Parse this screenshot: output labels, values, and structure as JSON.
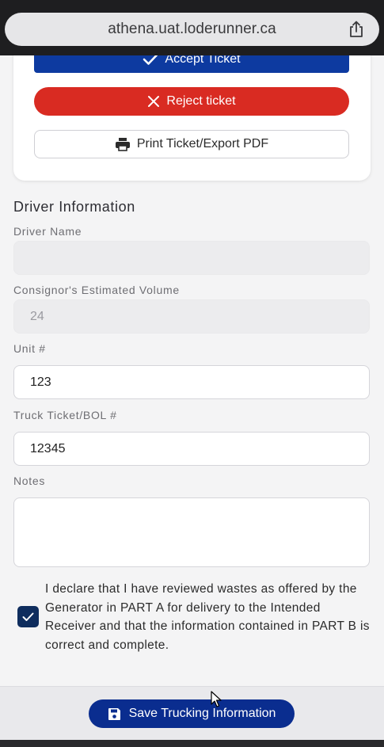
{
  "browser": {
    "url": "athena.uat.loderunner.ca"
  },
  "actions": {
    "accept_label": "Accept Ticket",
    "reject_label": "Reject ticket",
    "print_label": "Print Ticket/Export PDF"
  },
  "driver": {
    "section_title": "Driver Information",
    "driver_name_label": "Driver Name",
    "driver_name_value": "",
    "volume_label": "Consignor's Estimated Volume",
    "volume_value": "24",
    "unit_label": "Unit #",
    "unit_value": "123",
    "truck_ticket_label": "Truck Ticket/BOL #",
    "truck_ticket_value": "12345",
    "notes_label": "Notes",
    "notes_value": ""
  },
  "declaration": {
    "checked": true,
    "text": "I declare that I have reviewed wastes as offered by the Generator in PART A for delivery to the Intended Receiver and that the information contained in PART B is correct and complete."
  },
  "footer": {
    "save_label": "Save Trucking Information"
  },
  "colors": {
    "accept": "#0d3aa0",
    "reject": "#d92b22",
    "save": "#0a2d8f",
    "checkbox": "#0f2d5e"
  },
  "icons": [
    "share-icon",
    "check-icon",
    "x-icon",
    "printer-icon",
    "checkmark-icon",
    "save-icon",
    "cursor-icon"
  ]
}
